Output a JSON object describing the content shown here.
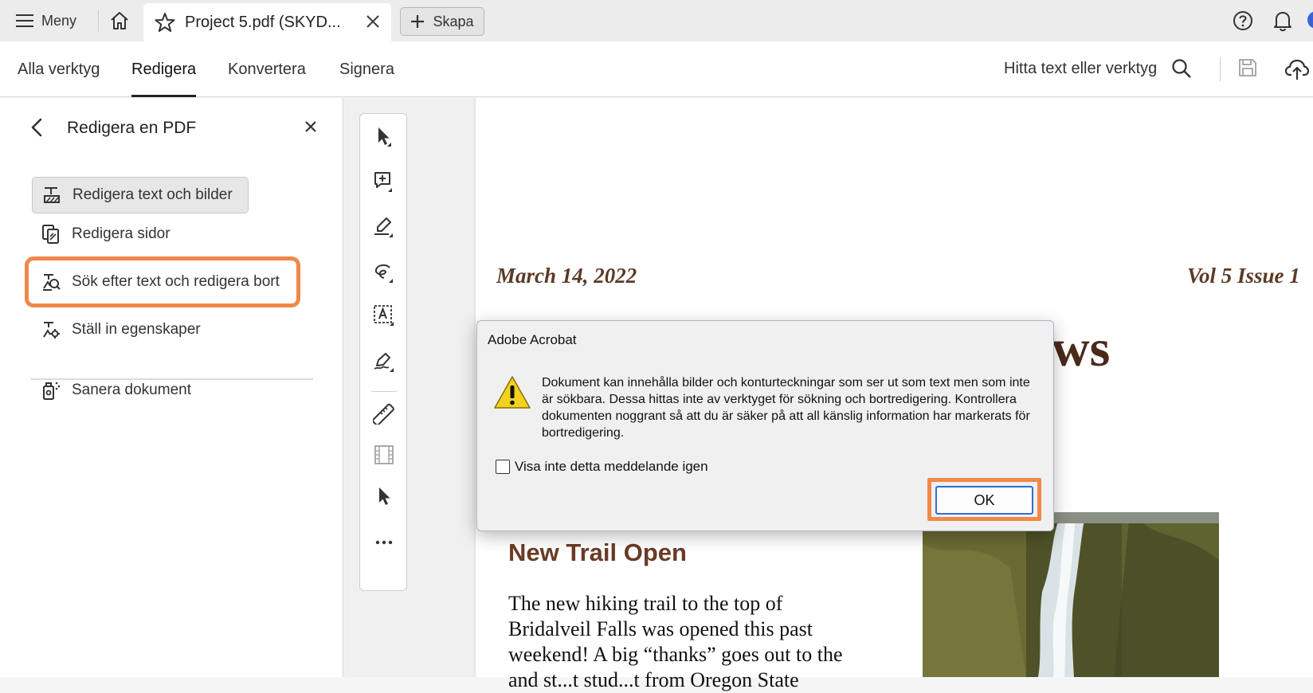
{
  "app": {
    "menu_label": "Meny",
    "tab_title": "Project 5.pdf (SKYD...",
    "create_label": "Skapa"
  },
  "toolbar": {
    "tabs": [
      {
        "label": "Alla verktyg",
        "active": false
      },
      {
        "label": "Redigera",
        "active": true
      },
      {
        "label": "Konvertera",
        "active": false
      },
      {
        "label": "Signera",
        "active": false
      }
    ],
    "find_label": "Hitta text eller verktyg"
  },
  "panel": {
    "title": "Redigera en PDF",
    "items": [
      {
        "label": "Redigera text och bilder",
        "icon": "edit-text-image-icon",
        "selected": true
      },
      {
        "label": "Redigera sidor",
        "icon": "edit-pages-icon"
      },
      {
        "label": "Sök efter text och redigera bort",
        "icon": "find-redact-icon",
        "highlighted": true
      },
      {
        "label": "Ställ in egenskaper",
        "icon": "set-properties-icon"
      },
      {
        "label": "Sanera dokument",
        "icon": "sanitize-icon"
      }
    ]
  },
  "vertical_tools": [
    "select-icon",
    "add-comment-icon",
    "highlight-icon",
    "draw-icon",
    "text-box-icon",
    "sign-icon",
    "measure-icon",
    "media-icon",
    "select-alt-icon",
    "more-icon"
  ],
  "document": {
    "date": "March 14, 2022",
    "volume": "Vol 5 Issue 1",
    "title_fragment": "ws",
    "article_heading": "New Trail Open",
    "article_lines": [
      "The new hiking trail to the top of",
      "Bridalveil Falls was opened this past",
      "weekend!  A big “thanks” goes out to the",
      "and st...t stud...t from Oregon State"
    ]
  },
  "dialog": {
    "title": "Adobe Acrobat",
    "message": "Dokument kan innehålla bilder och konturteckningar som ser ut som text men som inte är sökbara. Dessa hittas inte av verktyget för sökning och bortredigering. Kontrollera dokumenten noggrant så att du är säker på att all känslig information har markerats för bortredigering.",
    "checkbox_label": "Visa inte detta meddelande igen",
    "checkbox_checked": false,
    "ok_label": "OK"
  },
  "colors": {
    "highlight_orange": "#f0884a",
    "doc_brown": "#5b3a27"
  }
}
